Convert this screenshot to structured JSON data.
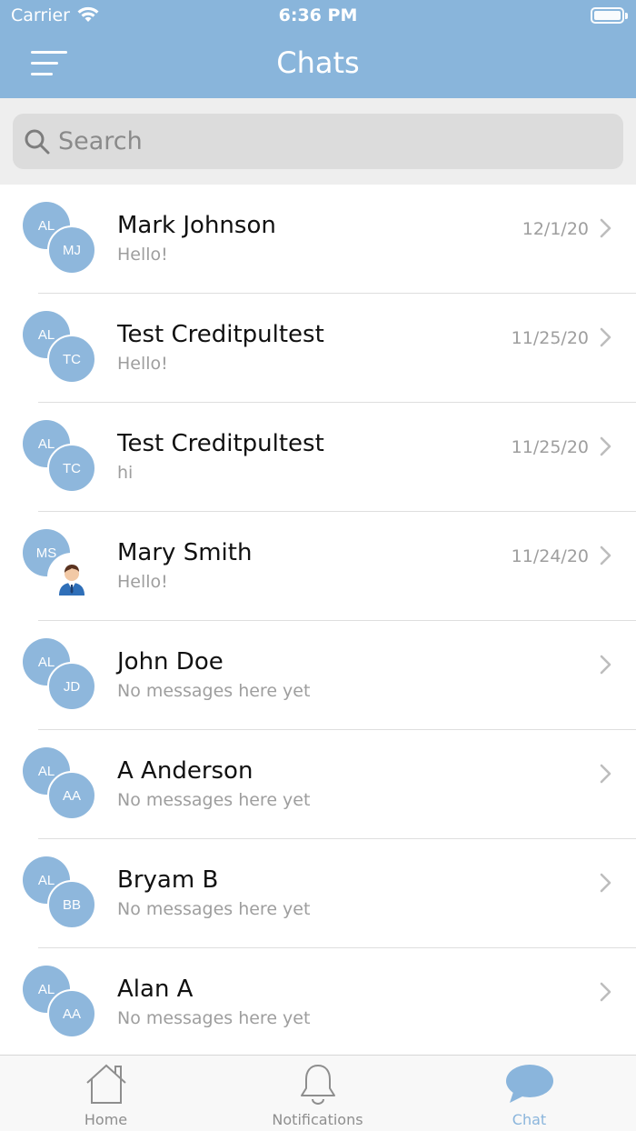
{
  "status_bar": {
    "carrier": "Carrier",
    "time": "6:36 PM"
  },
  "header": {
    "title": "Chats",
    "menu_icon": "hamburger-menu-icon"
  },
  "search": {
    "placeholder": "Search",
    "value": "",
    "icon": "search-icon"
  },
  "chats": [
    {
      "back_initials": "AL",
      "front_initials": "MJ",
      "name": "Mark Johnson",
      "preview": "Hello!",
      "date": "12/1/20"
    },
    {
      "back_initials": "AL",
      "front_initials": "TC",
      "name": "Test Creditpultest",
      "preview": "Hello!",
      "date": "11/25/20"
    },
    {
      "back_initials": "AL",
      "front_initials": "TC",
      "name": "Test Creditpultest",
      "preview": "hi",
      "date": "11/25/20"
    },
    {
      "back_initials": "MS",
      "front_initials": "",
      "front_photo": "user-photo-icon",
      "name": "Mary Smith",
      "preview": "Hello!",
      "date": "11/24/20"
    },
    {
      "back_initials": "AL",
      "front_initials": "JD",
      "name": "John Doe",
      "preview": "No messages here yet",
      "date": ""
    },
    {
      "back_initials": "AL",
      "front_initials": "AA",
      "name": "A Anderson",
      "preview": "No messages here yet",
      "date": ""
    },
    {
      "back_initials": "AL",
      "front_initials": "BB",
      "name": "Bryam B",
      "preview": "No messages here yet",
      "date": ""
    },
    {
      "back_initials": "AL",
      "front_initials": "AA",
      "name": "Alan A",
      "preview": "No messages here yet",
      "date": ""
    }
  ],
  "tabbar": {
    "home": "Home",
    "notifications": "Notifications",
    "chat": "Chat",
    "active": "chat"
  },
  "colors": {
    "header_bg": "#89b5db",
    "avatar_bg": "#8eb7dc",
    "active_tab": "#8ab5dc",
    "muted_text": "#9e9e9e"
  }
}
